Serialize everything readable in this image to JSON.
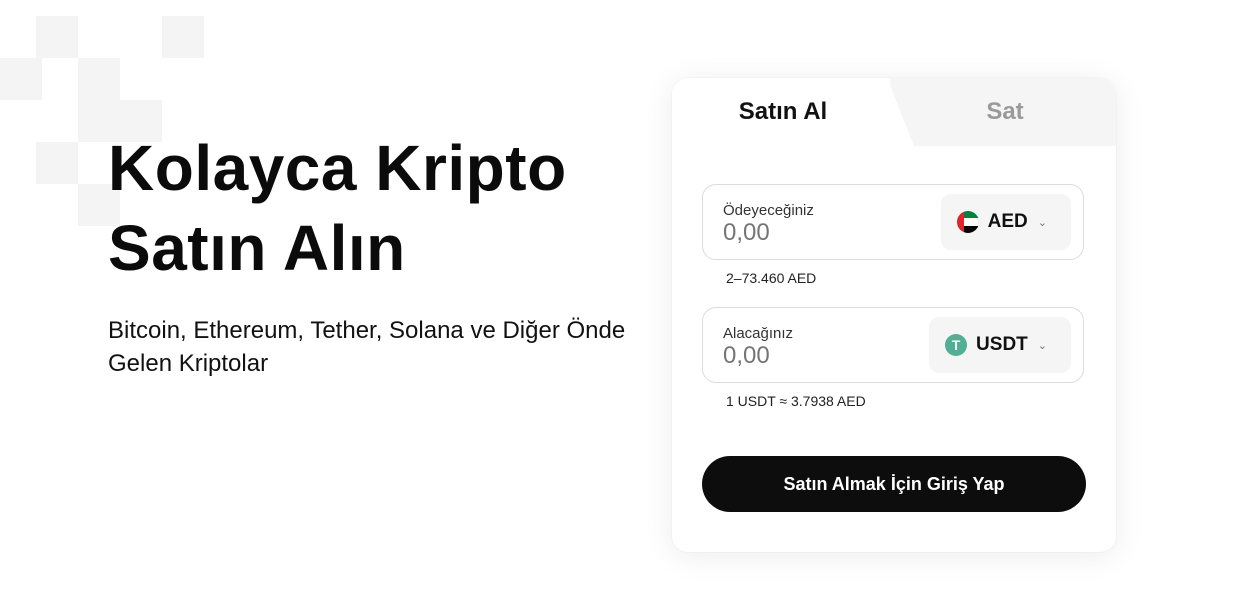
{
  "hero": {
    "title_line1": "Kolayca Kripto",
    "title_line2": "Satın Alın",
    "subtitle": "Bitcoin, Ethereum, Tether, Solana ve Diğer Önde Gelen Kriptolar"
  },
  "tabs": {
    "buy": "Satın Al",
    "sell": "Sat",
    "active": "buy"
  },
  "pay": {
    "label": "Ödeyeceğiniz",
    "placeholder": "0,00",
    "currency": "AED",
    "currency_icon": "uae-flag-icon",
    "range": "2–73.460 AED"
  },
  "receive": {
    "label": "Alacağınız",
    "placeholder": "0,00",
    "currency": "USDT",
    "currency_icon": "tether-icon",
    "rate": "1 USDT ≈ 3.7938 AED"
  },
  "submit_label": "Satın Almak İçin Giriş Yap",
  "colors": {
    "button_bg": "#0d0d0d",
    "tab_inactive_text": "#9a9a9a",
    "tether_green": "#50af95"
  }
}
